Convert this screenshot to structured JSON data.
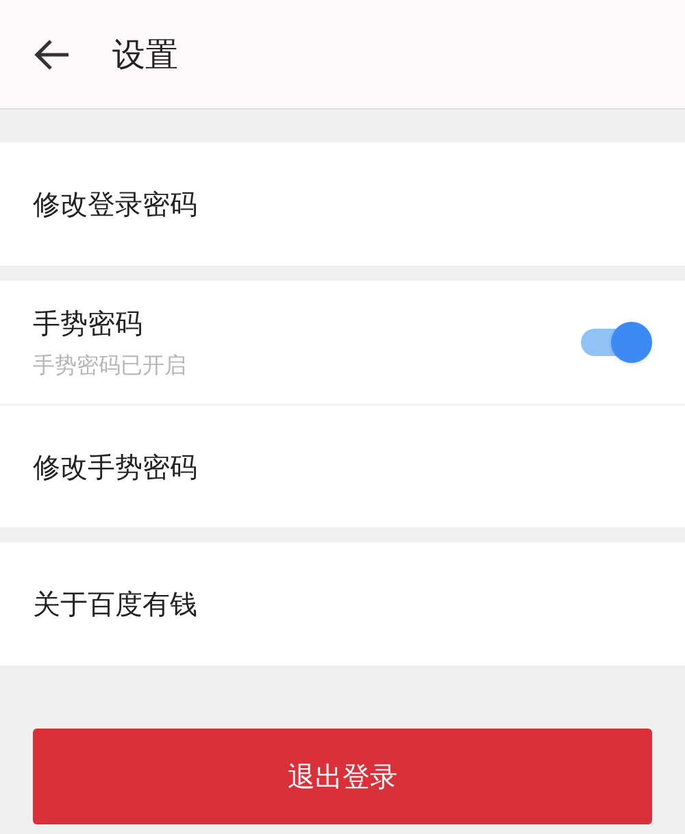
{
  "header": {
    "title": "设置"
  },
  "sections": [
    {
      "rows": [
        {
          "kind": "link",
          "label": "修改登录密码"
        }
      ]
    },
    {
      "rows": [
        {
          "kind": "toggle",
          "label": "手势密码",
          "subtitle": "手势密码已开启",
          "on": true
        },
        {
          "kind": "link",
          "label": "修改手势密码"
        }
      ]
    },
    {
      "rows": [
        {
          "kind": "link",
          "label": "关于百度有钱"
        }
      ]
    }
  ],
  "logout_button": {
    "label": "退出登录"
  }
}
